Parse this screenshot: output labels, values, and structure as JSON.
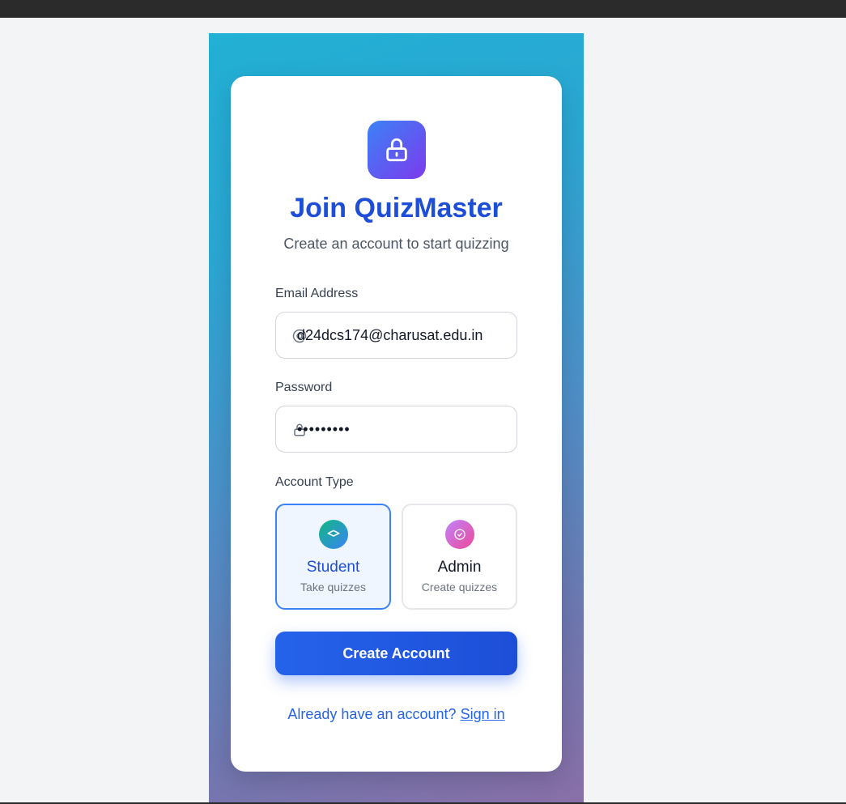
{
  "header": {
    "title": "Join QuizMaster",
    "subtitle": "Create an account to start quizzing"
  },
  "form": {
    "email_label": "Email Address",
    "email_value": "d24dcs174@charusat.edu.in",
    "password_label": "Password",
    "password_value": "•••••••••",
    "account_type_label": "Account Type",
    "account_types": [
      {
        "name": "Student",
        "desc": "Take quizzes",
        "selected": true
      },
      {
        "name": "Admin",
        "desc": "Create quizzes",
        "selected": false
      }
    ],
    "submit_label": "Create Account"
  },
  "footer": {
    "prompt": "Already have an account?",
    "link": "Sign in"
  },
  "colors": {
    "accent": "#1d4ed8",
    "button": "#2563eb",
    "logo_gradient": [
      "#3b82f6",
      "#7c3aed"
    ],
    "student_badge": [
      "#10b981",
      "#3b82f6"
    ],
    "admin_badge": [
      "#c084fc",
      "#ec4899"
    ]
  },
  "icons": {
    "logo": "lock-icon",
    "email": "at-sign-icon",
    "password": "lock-icon",
    "student": "graduation-cap-icon",
    "admin": "check-circle-icon"
  }
}
